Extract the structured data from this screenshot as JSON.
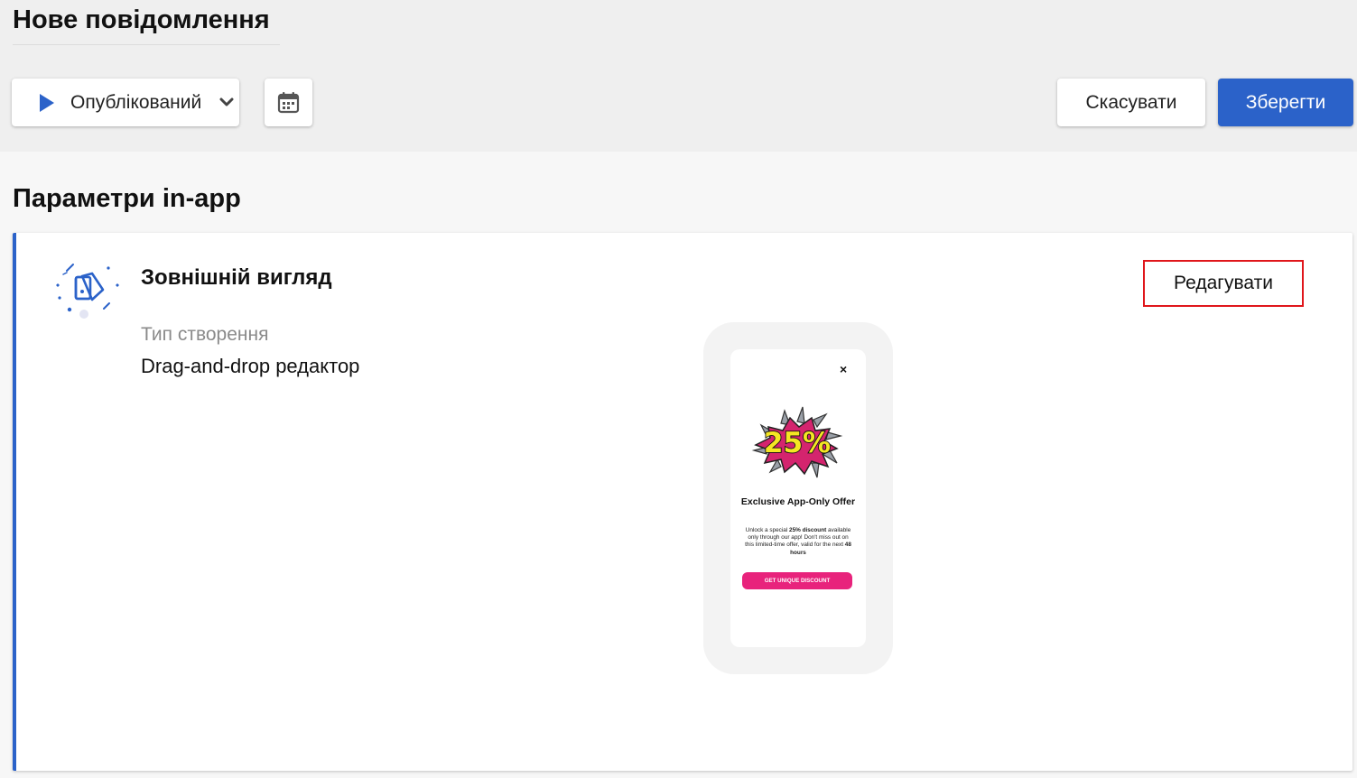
{
  "header": {
    "title": "Нове повідомлення",
    "status_select": {
      "value": "Опублікований",
      "icon": "play-icon"
    },
    "calendar_icon": "calendar-icon",
    "cancel_label": "Скасувати",
    "save_label": "Зберегти"
  },
  "section": {
    "title": "Параметри in-app"
  },
  "appearance_card": {
    "icon": "appearance-icon",
    "title": "Зовнішній вигляд",
    "edit_label": "Редагувати",
    "creation_type_label": "Тип створення",
    "creation_type_value": "Drag-and-drop редактор"
  },
  "preview": {
    "close_symbol": "×",
    "badge_text": "25%",
    "heading": "Exclusive App-Only Offer",
    "body_prefix": "Unlock a special ",
    "body_bold_1": "25% discount",
    "body_middle": " available only through our app! Don't miss out on this limited-time offer, valid for the next ",
    "body_bold_2": "48 hours",
    "cta_label": "GET UNIQUE DISCOUNT"
  },
  "colors": {
    "accent_blue": "#2b62c9",
    "highlight_red": "#e0161b",
    "cta_pink": "#e8237c",
    "badge_yellow": "#f5e623",
    "badge_pink": "#d4246e"
  }
}
